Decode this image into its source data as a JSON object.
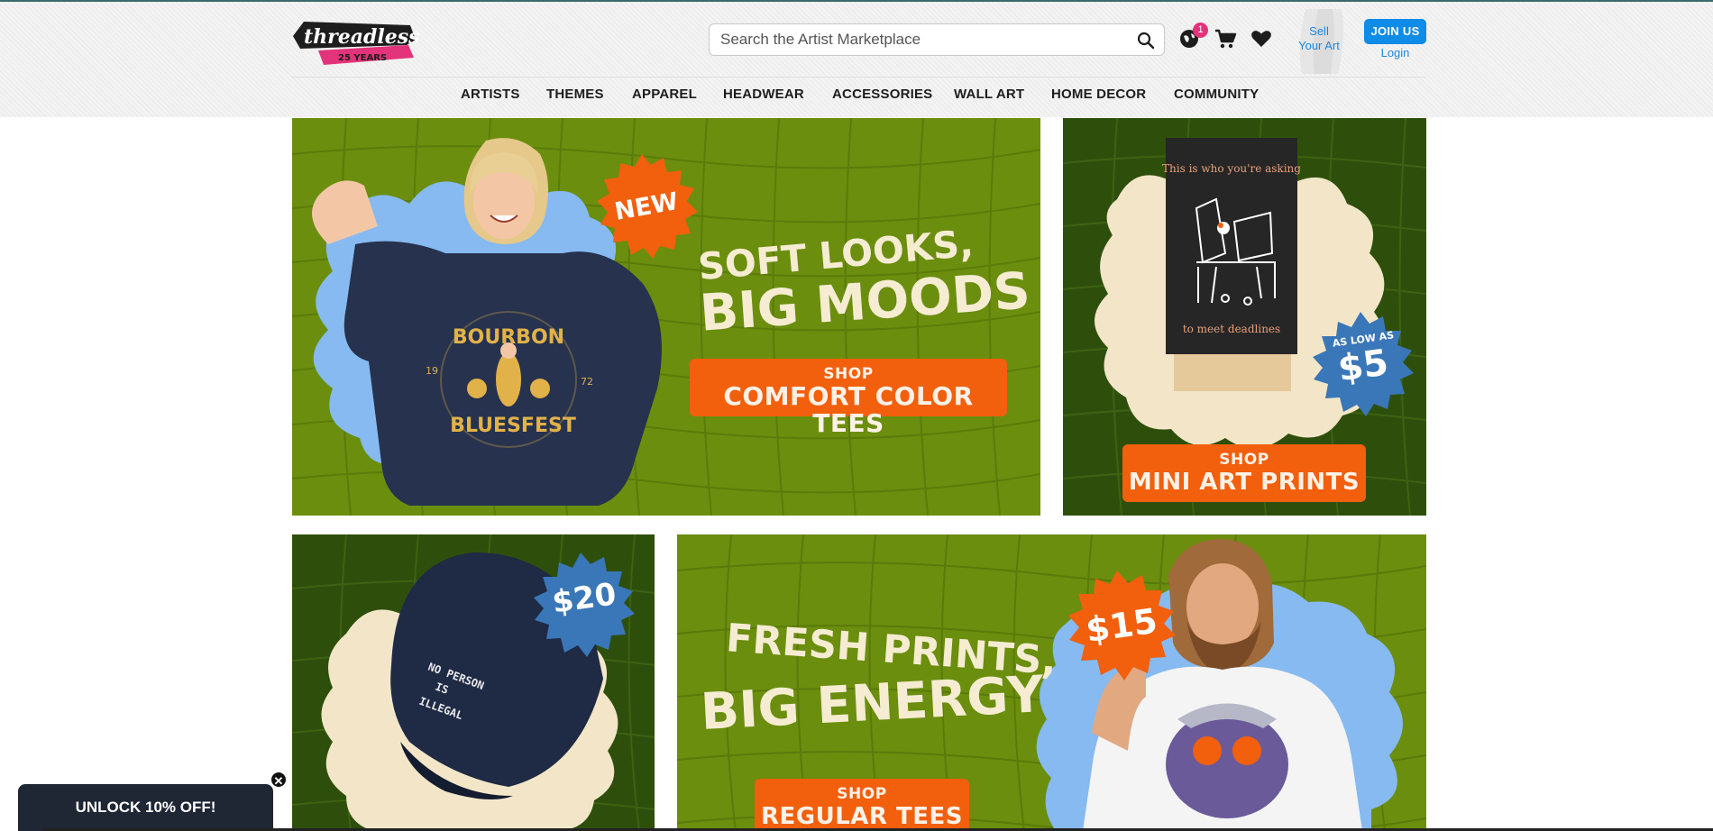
{
  "header": {
    "logo_text": "threadless",
    "logo_badge": "25 YEARS",
    "search_placeholder": "Search the Artist Marketplace",
    "notification_count": "1",
    "sell_line1": "Sell",
    "sell_line2": "Your Art",
    "join_label": "JOIN US",
    "login_label": "Login"
  },
  "nav": {
    "items": [
      "ARTISTS",
      "THEMES",
      "APPAREL",
      "HEADWEAR",
      "ACCESSORIES",
      "WALL ART",
      "HOME DECOR",
      "COMMUNITY"
    ]
  },
  "banners": {
    "comfort": {
      "badge": "NEW",
      "headline1": "SOFT LOOKS,",
      "headline2": "BIG MOODS",
      "shop_small": "SHOP",
      "shop_big": "COMFORT COLOR TEES",
      "shirt_text_top": "BOURBON",
      "shirt_text_bottom": "BLUESFEST",
      "shirt_year_left": "19",
      "shirt_year_right": "72"
    },
    "prints": {
      "print_top": "This is who you're asking",
      "print_bottom": "to meet deadlines",
      "price_small": "AS LOW AS",
      "price_big": "$5",
      "shop_small": "SHOP",
      "shop_big": "MINI ART PRINTS"
    },
    "hats": {
      "price": "$20",
      "cap_line1": "NO PERSON",
      "cap_line2": "IS",
      "cap_line3": "ILLEGAL"
    },
    "regular": {
      "price": "$15",
      "headline1": "FRESH PRINTS,",
      "headline2": "BIG ENERGY",
      "shop_small": "SHOP",
      "shop_big": "REGULAR TEES"
    }
  },
  "popup": {
    "label": "UNLOCK 10% OFF!",
    "close": "✕"
  },
  "colors": {
    "banner_green": "#6b8e0e",
    "banner_dark_green": "#2e4f0c",
    "orange": "#f25f0d",
    "blue_burst": "#3a77b8",
    "cream": "#f5ecd2",
    "link_blue": "#1a88e0"
  }
}
